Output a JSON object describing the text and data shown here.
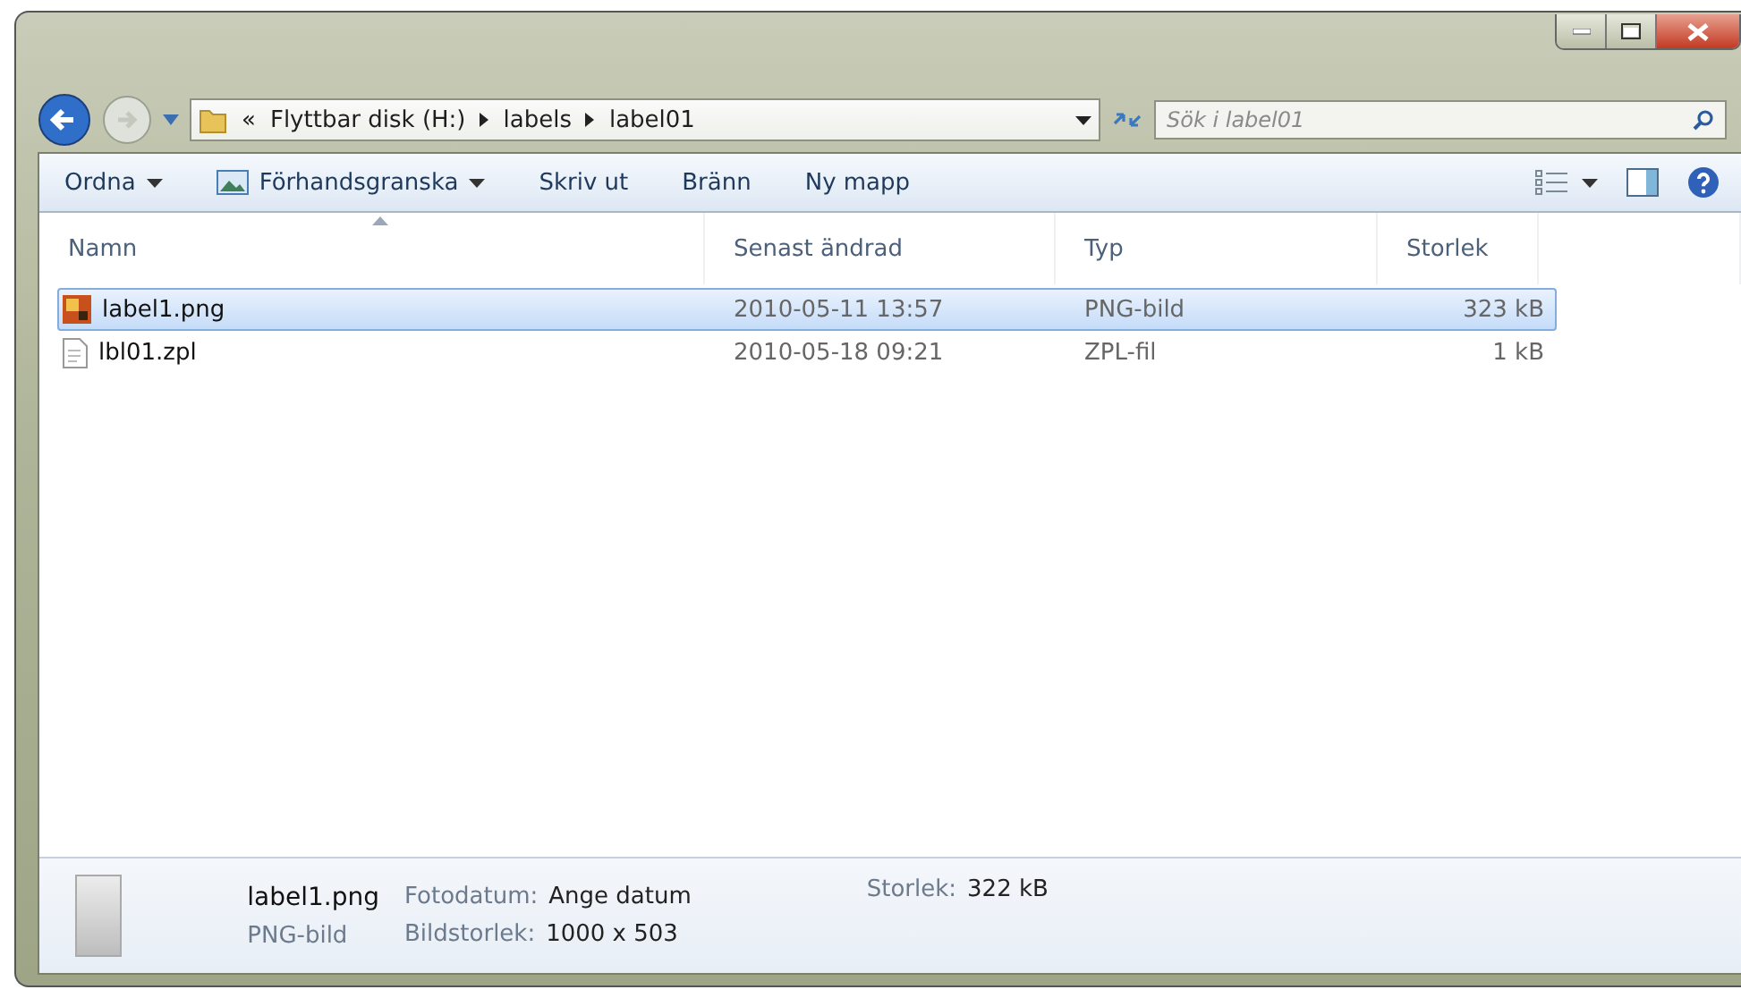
{
  "address": {
    "overflow": "«",
    "path": [
      "Flyttbar disk (H:)",
      "labels",
      "label01"
    ]
  },
  "search": {
    "placeholder": "Sök i label01"
  },
  "toolbar": [
    {
      "label": "Ordna",
      "dropdown": true,
      "kind": "text"
    },
    {
      "label": "Förhandsgranska",
      "dropdown": true,
      "kind": "preview"
    },
    {
      "label": "Skriv ut",
      "dropdown": false,
      "kind": "text"
    },
    {
      "label": "Bränn",
      "dropdown": false,
      "kind": "text"
    },
    {
      "label": "Ny mapp",
      "dropdown": false,
      "kind": "text"
    }
  ],
  "columns": [
    {
      "label": "Namn",
      "sorted": true
    },
    {
      "label": "Senast ändrad",
      "sorted": false
    },
    {
      "label": "Typ",
      "sorted": false
    },
    {
      "label": "Storlek",
      "sorted": false
    }
  ],
  "rows": [
    {
      "name": "label1.png",
      "modified": "2010-05-11 13:57",
      "type": "PNG-bild",
      "size": "323 kB",
      "selected": true,
      "kind": "image"
    },
    {
      "name": "lbl01.zpl",
      "modified": "2010-05-18 09:21",
      "type": "ZPL-fil",
      "size": "1 kB",
      "selected": false,
      "kind": "text"
    }
  ],
  "details": {
    "name": "label1.png",
    "type": "PNG-bild",
    "fields": [
      {
        "label": "Fotodatum:",
        "value": "Ange datum"
      },
      {
        "label": "Bildstorlek:",
        "value": "1000 x 503"
      },
      {
        "label": "Storlek:",
        "value": "322 kB"
      }
    ]
  }
}
